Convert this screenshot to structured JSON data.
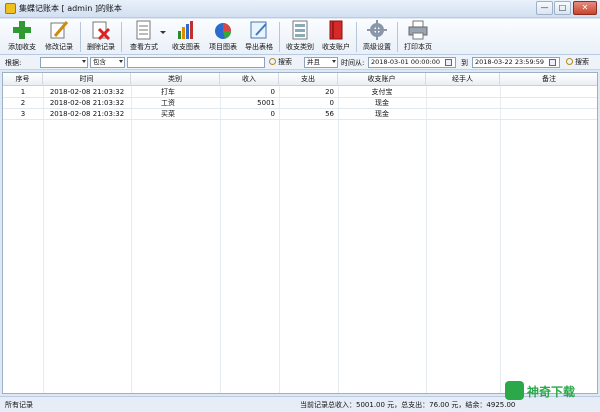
{
  "window": {
    "title": "集蝶记账本 [ admin ]的账本",
    "minimize": "—",
    "maximize": "□",
    "close": "✕"
  },
  "toolbar": {
    "buttons": [
      {
        "label": "添加收支",
        "icon": "add-icon"
      },
      {
        "label": "修改记录",
        "icon": "edit-icon"
      },
      {
        "label": "删除记录",
        "icon": "delete-icon"
      },
      {
        "label": "查看方式",
        "icon": "view-mode-icon"
      },
      {
        "label": "收支图表",
        "icon": "bar-chart-icon"
      },
      {
        "label": "项目图表",
        "icon": "pie-chart-icon"
      },
      {
        "label": "导出表格",
        "icon": "export-icon"
      },
      {
        "label": "收支类别",
        "icon": "category-icon"
      },
      {
        "label": "收支账户",
        "icon": "account-book-icon"
      },
      {
        "label": "高级设置",
        "icon": "settings-icon"
      },
      {
        "label": "打印本页",
        "icon": "printer-icon"
      }
    ]
  },
  "filter": {
    "by_label": "根据:",
    "by_value": "",
    "contains_value": "包含",
    "keyword_value": "",
    "search_label": "搜索",
    "and_value": "并且",
    "time_from_label": "时间从:",
    "time_from_value": "2018-03-01 00:00:00",
    "to_label": "到",
    "time_to_value": "2018-03-22 23:59:59",
    "search2_label": "搜索"
  },
  "table": {
    "columns": [
      "序号",
      "时间",
      "类别",
      "收入",
      "支出",
      "收支账户",
      "经手人",
      "备注"
    ],
    "rows": [
      {
        "no": "1",
        "time": "2018-02-08 21:03:32",
        "category": "打车",
        "income": "0",
        "expense": "20",
        "account": "支付宝",
        "handler": "",
        "note": ""
      },
      {
        "no": "2",
        "time": "2018-02-08 21:03:32",
        "category": "工资",
        "income": "5001",
        "expense": "0",
        "account": "现金",
        "handler": "",
        "note": ""
      },
      {
        "no": "3",
        "time": "2018-02-08 21:03:32",
        "category": "买菜",
        "income": "0",
        "expense": "56",
        "account": "现金",
        "handler": "",
        "note": ""
      }
    ]
  },
  "status": {
    "left": "所有记录",
    "summary": "当前记录总收入：5001.00 元，总支出：76.00 元，结余：4925.00"
  },
  "watermark": {
    "text": "神奇下载"
  },
  "colors": {
    "accent": "#2aa84a",
    "header_bg": "#dfe8f3"
  }
}
